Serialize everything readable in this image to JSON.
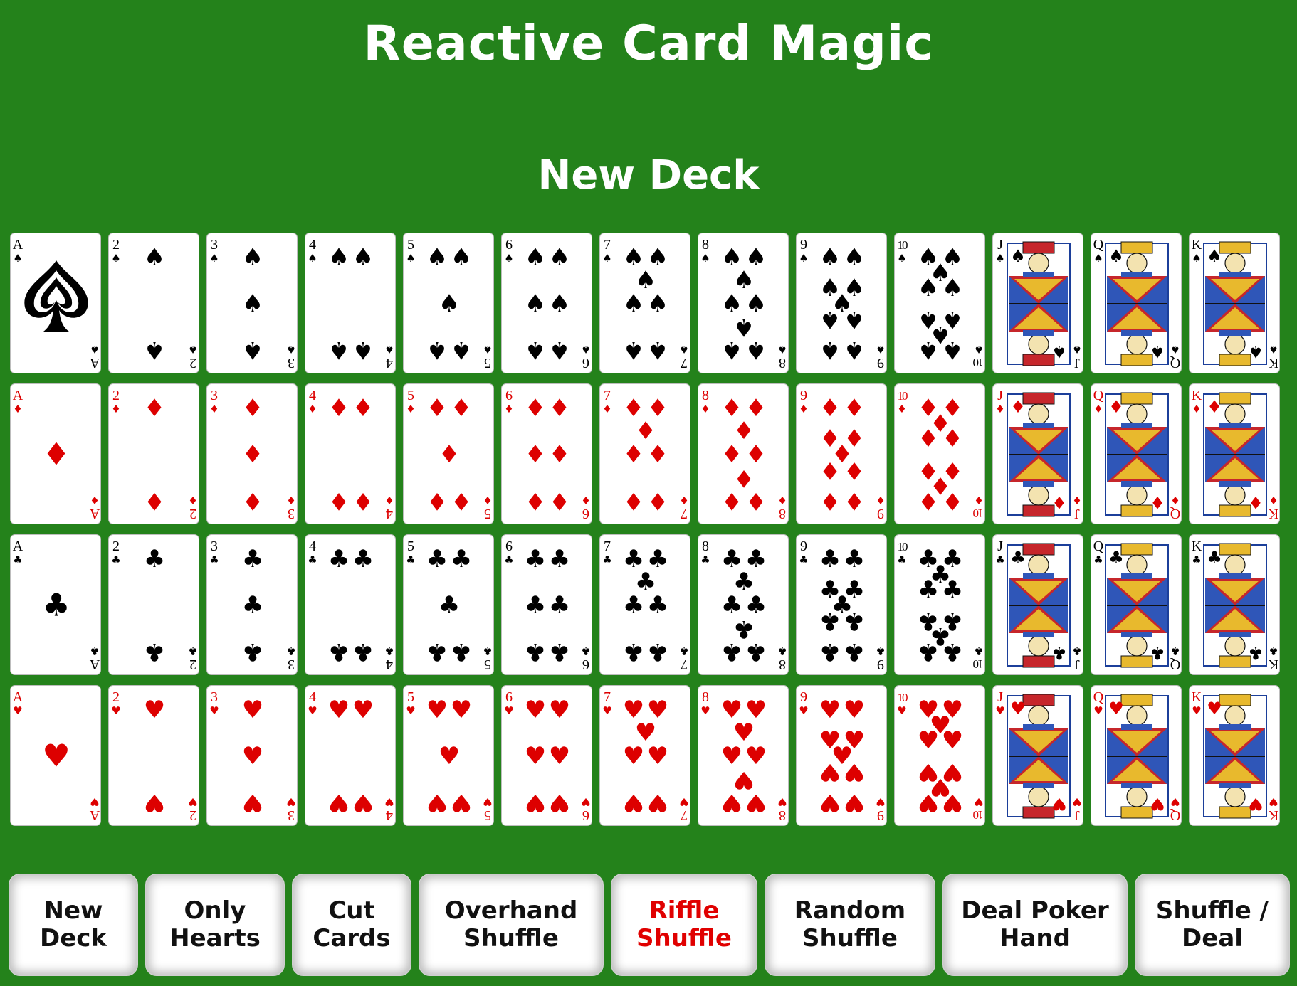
{
  "app": {
    "title": "Reactive Card Magic",
    "subtitle": "New Deck"
  },
  "colors": {
    "table": "#24821b",
    "black_suit": "#000000",
    "red_suit": "#dd0000",
    "active_button_text": "#e00000"
  },
  "deck": {
    "ranks": [
      "A",
      "2",
      "3",
      "4",
      "5",
      "6",
      "7",
      "8",
      "9",
      "10",
      "J",
      "Q",
      "K"
    ],
    "rows": [
      {
        "suit": "spades",
        "symbol": "♠",
        "color": "black"
      },
      {
        "suit": "diamonds",
        "symbol": "♦",
        "color": "red"
      },
      {
        "suit": "clubs",
        "symbol": "♣",
        "color": "black"
      },
      {
        "suit": "hearts",
        "symbol": "♥",
        "color": "red"
      }
    ]
  },
  "toolbar": {
    "buttons": [
      {
        "id": "new-deck",
        "label": "New\nDeck",
        "active": false
      },
      {
        "id": "only-hearts",
        "label": "Only\nHearts",
        "active": false
      },
      {
        "id": "cut-cards",
        "label": "Cut\nCards",
        "active": false
      },
      {
        "id": "overhand-shuffle",
        "label": "Overhand\nShuffle",
        "active": false
      },
      {
        "id": "riffle-shuffle",
        "label": "Riffle\nShuffle",
        "active": true
      },
      {
        "id": "random-shuffle",
        "label": "Random\nShuffle",
        "active": false
      },
      {
        "id": "deal-poker-hand",
        "label": "Deal Poker\nHand",
        "active": false
      },
      {
        "id": "shuffle-deal",
        "label": "Shuffle /\nDeal",
        "active": false
      }
    ]
  }
}
